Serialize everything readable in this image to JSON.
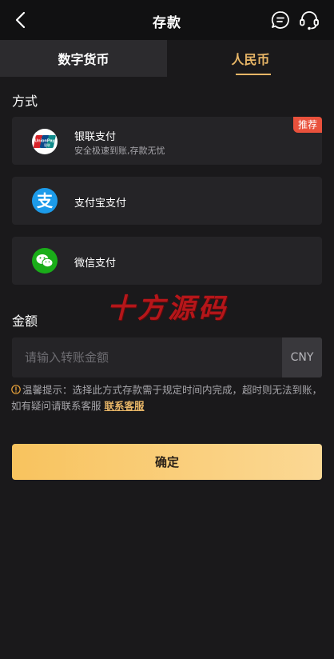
{
  "header": {
    "title": "存款"
  },
  "tabs": [
    {
      "label": "数字货币",
      "active": false
    },
    {
      "label": "人民币",
      "active": true
    }
  ],
  "method_section": {
    "label": "方式"
  },
  "methods": [
    {
      "name": "银联支付",
      "desc": "安全极速到账,存款无忧",
      "badge": "推荐",
      "icon": "unionpay-icon",
      "logo_text": "UnionPay",
      "logo_subtext": "银联"
    },
    {
      "name": "支付宝支付",
      "desc": "",
      "icon": "alipay-icon",
      "logo_text": "支"
    },
    {
      "name": "微信支付",
      "desc": "",
      "icon": "wechat-icon"
    }
  ],
  "watermark": "十方源码",
  "amount_section": {
    "label": "金额",
    "placeholder": "请输入转账金额",
    "value": "",
    "currency": "CNY"
  },
  "tip": {
    "text": "温馨提示：选择此方式存款需于规定时间内完成，超时则无法到账，如有疑问请联系客服",
    "link": "联系客服"
  },
  "confirm_label": "确定",
  "colors": {
    "accent": "#e8b667",
    "badge": "#e9513c",
    "background": "#1a191b",
    "card": "#252427"
  }
}
